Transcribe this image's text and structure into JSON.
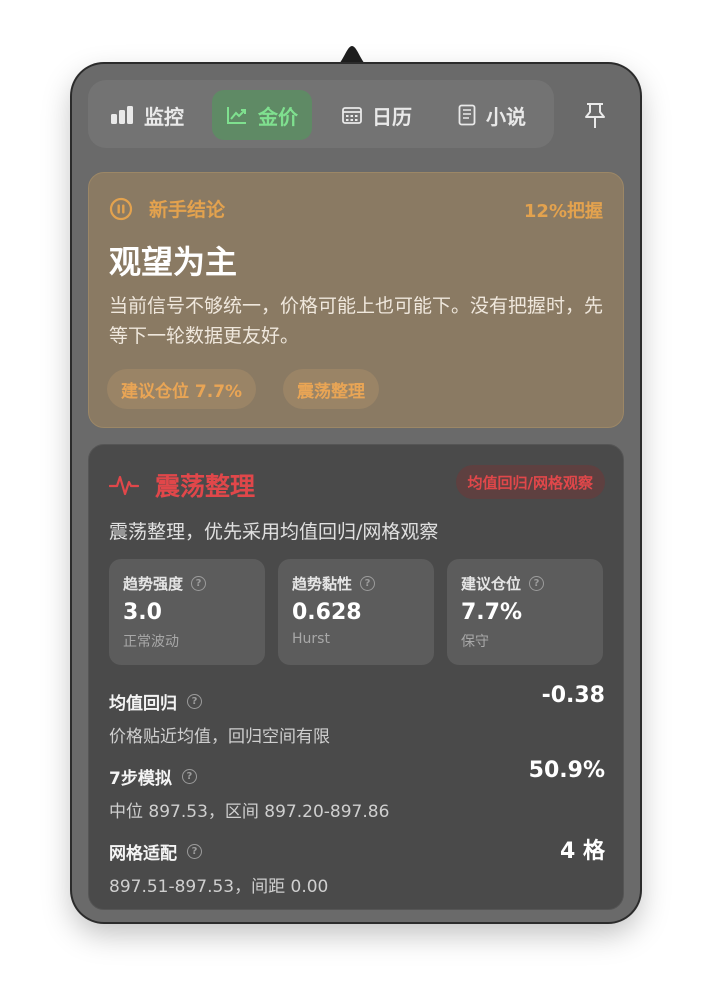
{
  "tabs": [
    {
      "label": "监控",
      "icon": "bar-chart-icon",
      "active": false
    },
    {
      "label": "金价",
      "icon": "trend-chart-icon",
      "active": true
    },
    {
      "label": "日历",
      "icon": "calendar-icon",
      "active": false
    },
    {
      "label": "小说",
      "icon": "book-icon",
      "active": false
    }
  ],
  "pin_icon": "pin-icon",
  "advice": {
    "header": "新手结论",
    "confidence": "12%把握",
    "title": "观望为主",
    "description": "当前信号不够统一，价格可能上也可能下。没有把握时，先等下一轮数据更友好。",
    "chips": [
      "建议仓位 7.7%",
      "震荡整理"
    ]
  },
  "regime": {
    "title": "震荡整理",
    "badge": "均值回归/网格观察",
    "description": "震荡整理，优先采用均值回归/网格观察",
    "metrics": [
      {
        "label": "趋势强度",
        "value": "3.0",
        "sub": "正常波动"
      },
      {
        "label": "趋势黏性",
        "value": "0.628",
        "sub": "Hurst"
      },
      {
        "label": "建议仓位",
        "value": "7.7%",
        "sub": "保守"
      }
    ],
    "rows": [
      {
        "label": "均值回归",
        "value": "-0.38",
        "sub": "价格贴近均值，回归空间有限"
      },
      {
        "label": "7步模拟",
        "value": "50.9%",
        "sub": "中位 897.53，区间 897.20-897.86"
      },
      {
        "label": "网格适配",
        "value": "4 格",
        "sub": "897.51-897.53，间距 0.00"
      }
    ]
  },
  "colors": {
    "panel": "#6a6a6a",
    "accent_green": "#7fe08f",
    "accent_orange": "#e3a24e",
    "accent_red": "#e0474a"
  }
}
